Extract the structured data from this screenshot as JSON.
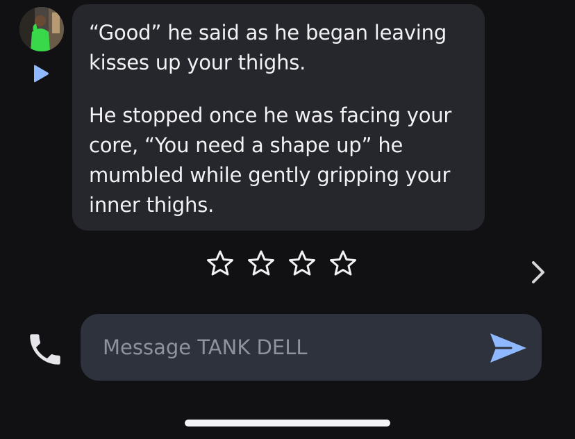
{
  "colors": {
    "background": "#111114",
    "bubble": "#26272c",
    "input_background": "#2e323d",
    "accent_blue": "#8eb8ff",
    "text": "#f2f2f4",
    "placeholder": "#8f939e"
  },
  "contact": {
    "avatar": "avatar-photo",
    "play_icon": "play-icon"
  },
  "message": {
    "paragraphs": [
      "“Good” he said as he began leaving kisses up your thighs.",
      "He stopped once he was facing your core, “You need a shape up” he mumbled while gently gripping your inner thighs."
    ]
  },
  "rating": {
    "max_stars": 4,
    "selected": 0,
    "icon": "star-outline-icon"
  },
  "navigation": {
    "next_icon": "chevron-right-icon"
  },
  "composer": {
    "call_icon": "phone-icon",
    "placeholder": "Message TANK DELL",
    "value": "",
    "send_icon": "send-icon"
  }
}
